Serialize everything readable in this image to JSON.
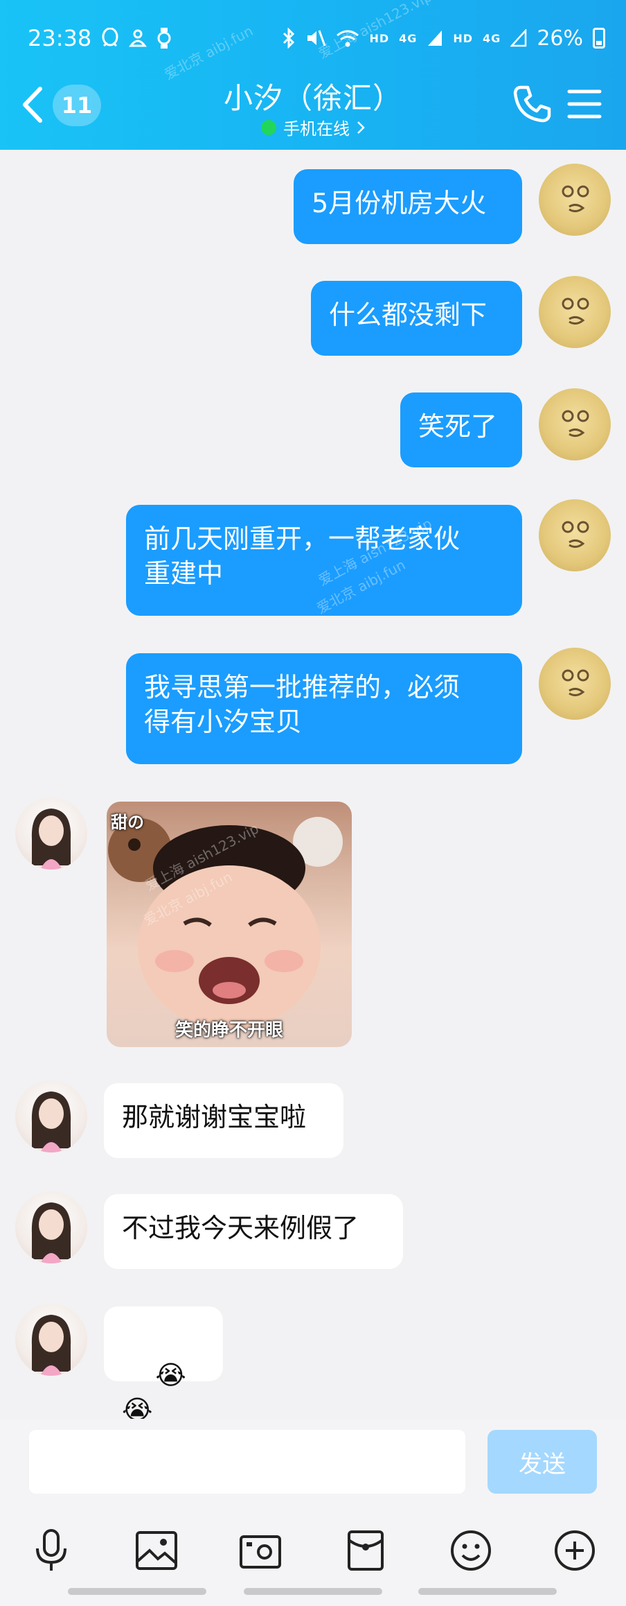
{
  "status_bar": {
    "time": "23:38",
    "network_1": "HD",
    "network_2": "4G",
    "network_3": "HD",
    "network_4": "4G",
    "battery": "26%"
  },
  "header": {
    "unread_count": "11",
    "title": "小汐（徐汇）",
    "presence": "手机在线"
  },
  "messages": [
    {
      "from": "me",
      "text": "5月份机房大火"
    },
    {
      "from": "me",
      "text": "什么都没剩下"
    },
    {
      "from": "me",
      "text": "笑死了"
    },
    {
      "from": "me",
      "text": "前几天刚重开，一帮老家伙\n重建中"
    },
    {
      "from": "me",
      "text": "我寻思第一批推荐的，必须\n得有小汐宝贝"
    },
    {
      "from": "her",
      "sticker_top": "甜の",
      "sticker_bottom": "笑的睁不开眼"
    },
    {
      "from": "her",
      "text": "那就谢谢宝宝啦"
    },
    {
      "from": "her",
      "text": "不过我今天来例假了"
    },
    {
      "from": "her",
      "emoji": "😭😭"
    }
  ],
  "composer": {
    "input_value": "",
    "send_label": "发送"
  },
  "watermarks": [
    "爱上海 aish123.vip",
    "爱北京 aibj.fun"
  ],
  "colors": {
    "header": "#19c3f6",
    "my_bubble": "#1a9dff",
    "her_bubble": "#ffffff",
    "send_button": "#a4d8ff"
  }
}
